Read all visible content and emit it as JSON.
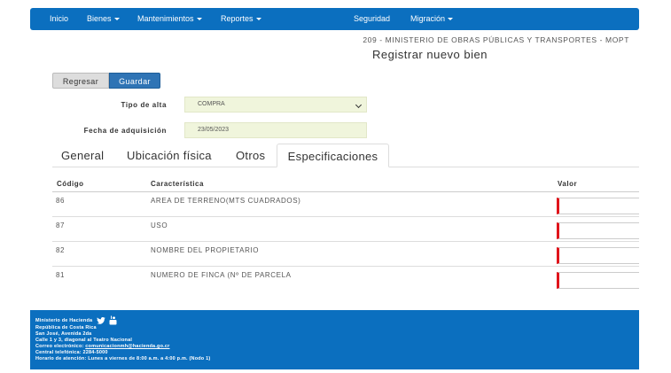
{
  "nav": {
    "inicio": "Inicio",
    "bienes": "Bienes",
    "mantenimientos": "Mantenimientos",
    "reportes": "Reportes",
    "seguridad": "Seguridad",
    "migracion": "Migración"
  },
  "header": {
    "ministry": "209 - MINISTERIO DE OBRAS PÚBLICAS Y TRANSPORTES - MOPT",
    "title": "Registrar nuevo bien"
  },
  "buttons": {
    "back": "Regresar",
    "save": "Guardar"
  },
  "form": {
    "tipo_alta_label": "Tipo de alta",
    "tipo_alta_value": "COMPRA",
    "fecha_label": "Fecha de adquisición",
    "fecha_value": "23/05/2023"
  },
  "tabs": [
    "General",
    "Ubicación física",
    "Otros",
    "Especificaciones"
  ],
  "table": {
    "headers": {
      "codigo": "Código",
      "caracteristica": "Característica",
      "valor": "Valor"
    },
    "rows": [
      {
        "codigo": "86",
        "caracteristica": "AREA DE TERRENO(MTS CUADRADOS)",
        "valor": ""
      },
      {
        "codigo": "87",
        "caracteristica": "USO",
        "valor": ""
      },
      {
        "codigo": "82",
        "caracteristica": "NOMBRE DEL PROPIETARIO",
        "valor": ""
      },
      {
        "codigo": "81",
        "caracteristica": "NUMERO DE FINCA (Nº DE PARCELA",
        "valor": ""
      }
    ]
  },
  "footer": {
    "name": "Ministerio de Hacienda",
    "country": "República de Costa Rica",
    "address1": "San José, Avenida 2da",
    "address2": "Calle 1 y 3, diagonal al Teatro Nacional",
    "email_label": "Correo electrónico:",
    "email": "comunicacionmh@hacienda.go.cr",
    "phone": "Central telefónica: 2284-5000",
    "hours": "Horario de atención: Lunes a viernes de 8:00 a.m. a 4:00 p.m. (Nodo 1)"
  },
  "colors": {
    "primary": "#0b6fbf",
    "save_button": "#2f74b5",
    "field_bg": "#f0f5dc",
    "required_marker": "#e0141b"
  },
  "icons": {
    "dropdown": "caret-down-icon",
    "select": "chevron-down-icon",
    "social1": "twitter-icon",
    "social2": "youtube-icon"
  }
}
